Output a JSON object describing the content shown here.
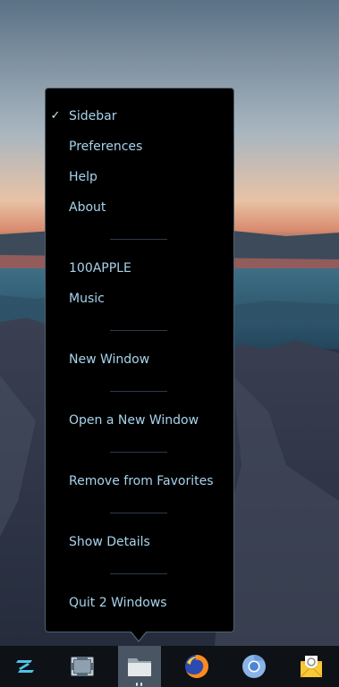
{
  "menu": {
    "items": [
      {
        "label": "Sidebar",
        "checked": true
      },
      {
        "label": "Preferences"
      },
      {
        "label": "Help"
      },
      {
        "label": "About"
      },
      {
        "label": "100APPLE"
      },
      {
        "label": "Music"
      },
      {
        "label": "New Window"
      },
      {
        "label": "Open a New Window"
      },
      {
        "label": "Remove from Favorites"
      },
      {
        "label": "Show Details"
      },
      {
        "label": "Quit 2 Windows"
      }
    ],
    "check_glyph": "✓",
    "text_color": "#a7d3ec"
  },
  "dock": {
    "items": [
      {
        "icon": "zorin-logo-icon"
      },
      {
        "icon": "screenshot-icon"
      },
      {
        "icon": "files-folder-icon",
        "active": true,
        "running_windows": 2
      },
      {
        "icon": "firefox-icon"
      },
      {
        "icon": "chromium-icon"
      },
      {
        "icon": "mail-icon"
      }
    ]
  }
}
